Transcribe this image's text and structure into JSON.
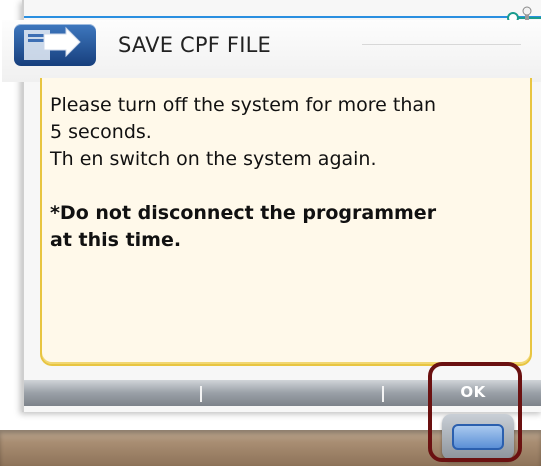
{
  "dialog": {
    "title": "SAVE CPF FILE"
  },
  "message": {
    "line1": "Please turn off the system for more than",
    "line2": "5 seconds.",
    "line3": "Th en switch on the system again.",
    "warning_line1": "*Do not disconnect the programmer",
    "warning_line2": "at this time."
  },
  "softkeys": {
    "ok_label": "OK"
  },
  "icons": {
    "title_icon": "save-file-icon",
    "status_icon": "connection-status-icon",
    "hardware_button": "hardware-softkey-button"
  },
  "colors": {
    "panel_border": "#e8c541",
    "panel_background": "#fff9ea",
    "title_icon": "#2a5ca3",
    "highlight": "#6b1111"
  }
}
